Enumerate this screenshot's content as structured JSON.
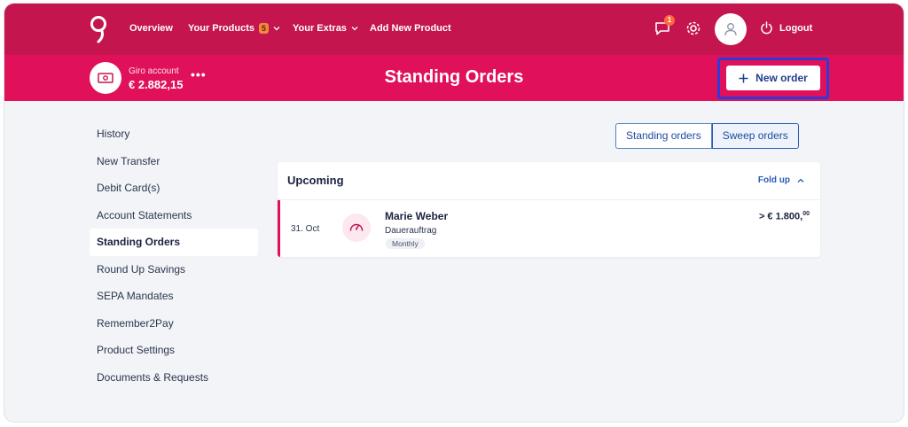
{
  "nav": {
    "logo_icon": "bank-logo-icon",
    "overview": "Overview",
    "products": "Your Products",
    "products_count": "5",
    "extras": "Your Extras",
    "add_product": "Add New Product",
    "notification_count": "1",
    "logout": "Logout"
  },
  "account": {
    "name": "Giro account",
    "balance": "€ 2.882,15",
    "more": "•••"
  },
  "page_title": "Standing Orders",
  "new_order_label": "New order",
  "sidebar": {
    "items": [
      {
        "label": "History"
      },
      {
        "label": "New Transfer"
      },
      {
        "label": "Debit Card(s)"
      },
      {
        "label": "Account Statements"
      },
      {
        "label": "Standing Orders"
      },
      {
        "label": "Round Up Savings"
      },
      {
        "label": "SEPA Mandates"
      },
      {
        "label": "Remember2Pay"
      },
      {
        "label": "Product Settings"
      },
      {
        "label": "Documents & Requests"
      }
    ],
    "active_item": "Standing Orders"
  },
  "toggle": {
    "standing": "Standing orders",
    "sweep": "Sweep orders"
  },
  "upcoming": {
    "title": "Upcoming",
    "fold_label": "Fold up",
    "orders": [
      {
        "date": "31. Oct",
        "name": "Marie Weber",
        "type": "Dauerauftrag",
        "frequency": "Monthly",
        "amount_main": "> € 1.800,",
        "amount_cents": "00"
      }
    ]
  },
  "colors": {
    "topbar": "#c4154e",
    "subbar": "#e0115a",
    "accent_blue": "#2a5cb4",
    "highlight": "#2f3bd6"
  }
}
